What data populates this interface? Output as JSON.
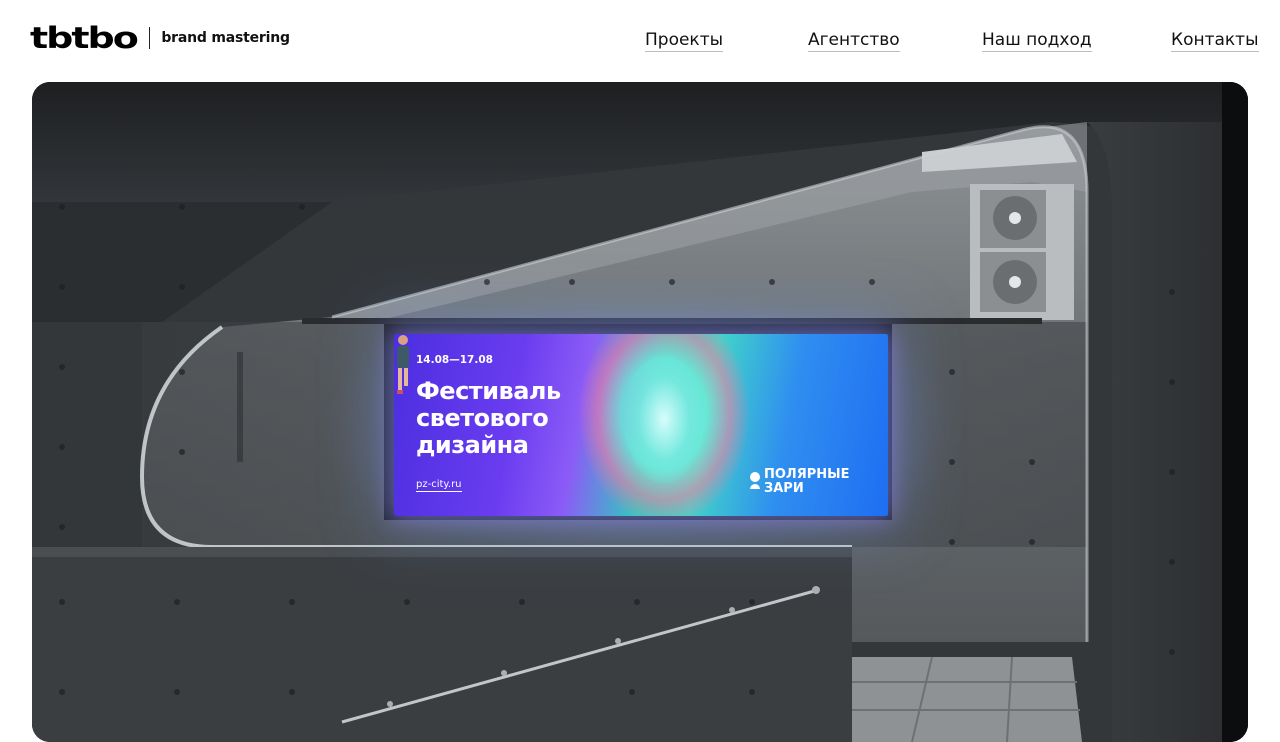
{
  "header": {
    "logo": "tbtbo",
    "tagline": "brand mastering"
  },
  "nav": {
    "items": [
      {
        "label": "Проекты"
      },
      {
        "label": "Агентство"
      },
      {
        "label": "Наш подход"
      },
      {
        "label": "Контакты"
      }
    ]
  },
  "hero": {
    "billboard": {
      "dates": "14.08—17.08",
      "title": "Фестиваль\nсветового\nдизайна",
      "url": "pz-city.ru",
      "brand": "ПОЛЯРНЫЕ\nЗАРИ"
    }
  },
  "colors": {
    "page_background": "#ffffff",
    "concrete": "#3a3d40",
    "billboard_violet": "#5b35e8",
    "billboard_cyan": "#40d2c6",
    "billboard_blue": "#2274f2"
  }
}
